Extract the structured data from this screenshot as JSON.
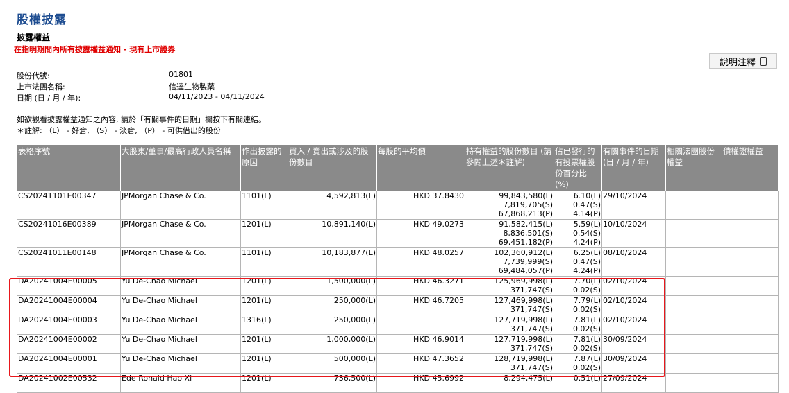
{
  "header": {
    "page_title": "股權披露",
    "section_title": "披露權益",
    "subtitle": "在指明期間內所有披露權益通知 - 現有上市證券",
    "help_button": "說明注釋"
  },
  "info": {
    "stock_code_label": "股份代號:",
    "stock_code": "01801",
    "company_label": "上市法團名稱:",
    "company": "信達生物製藥",
    "date_label": "日期 (日 / 月 / 年):",
    "date_range": "04/11/2023 - 04/11/2024"
  },
  "notes": {
    "line1": "如欲觀看披露權益通知之內容, 請於「有關事件的日期」欄按下有關連結。",
    "line2": "＊註解: （L） - 好倉, （S） - 淡倉, （P） - 可供借出的股份"
  },
  "table": {
    "headers": [
      "表格序號",
      "大股東/董事/最高行政人員名稱",
      "作出披露的原因",
      "買入 / 賣出或涉及的股份數目",
      "每股的平均價",
      "持有權益的股份數目 (請參閱上述＊註解)",
      "佔已發行的有投票權股份百分比 (%)",
      "有關事件的日期 (日 / 月 / 年)",
      "相關法團股份權益",
      "債權證權益"
    ],
    "rows": [
      {
        "form": "CS20241101E00347",
        "name": "JPMorgan Chase & Co.",
        "reason": "1101(L)",
        "shares": "4,592,813(L)",
        "price": "HKD 37.8430",
        "held": [
          "99,843,580(L)",
          "7,819,705(S)",
          "67,868,213(P)"
        ],
        "pct": [
          "6.10(L)",
          "0.47(S)",
          "4.14(P)"
        ],
        "date": "29/10/2024"
      },
      {
        "form": "CS20241016E00389",
        "name": "JPMorgan Chase & Co.",
        "reason": "1201(L)",
        "shares": "10,891,140(L)",
        "price": "HKD 49.0273",
        "held": [
          "91,582,415(L)",
          "8,836,501(S)",
          "69,451,182(P)"
        ],
        "pct": [
          "5.59(L)",
          "0.54(S)",
          "4.24(P)"
        ],
        "date": "10/10/2024"
      },
      {
        "form": "CS20241011E00148",
        "name": "JPMorgan Chase & Co.",
        "reason": "1101(L)",
        "shares": "10,183,877(L)",
        "price": "HKD 48.0257",
        "held": [
          "102,360,912(L)",
          "7,739,999(S)",
          "69,484,057(P)"
        ],
        "pct": [
          "6.25(L)",
          "0.47(S)",
          "4.24(P)"
        ],
        "date": "08/10/2024"
      },
      {
        "form": "DA20241004E00005",
        "name": "Yu De-Chao Michael",
        "reason": "1201(L)",
        "shares": "1,500,000(L)",
        "price": "HKD 46.3271",
        "held": [
          "125,969,998(L)",
          "371,747(S)"
        ],
        "pct": [
          "7.70(L)",
          "0.02(S)"
        ],
        "date": "02/10/2024"
      },
      {
        "form": "DA20241004E00004",
        "name": "Yu De-Chao Michael",
        "reason": "1201(L)",
        "shares": "250,000(L)",
        "price": "HKD 46.7205",
        "held": [
          "127,469,998(L)",
          "371,747(S)"
        ],
        "pct": [
          "7.79(L)",
          "0.02(S)"
        ],
        "date": "02/10/2024"
      },
      {
        "form": "DA20241004E00003",
        "name": "Yu De-Chao Michael",
        "reason": "1316(L)",
        "shares": "250,000(L)",
        "price": "",
        "held": [
          "127,719,998(L)",
          "371,747(S)"
        ],
        "pct": [
          "7.81(L)",
          "0.02(S)"
        ],
        "date": "02/10/2024"
      },
      {
        "form": "DA20241004E00002",
        "name": "Yu De-Chao Michael",
        "reason": "1201(L)",
        "shares": "1,000,000(L)",
        "price": "HKD 46.9014",
        "held": [
          "127,719,998(L)",
          "371,747(S)"
        ],
        "pct": [
          "7.81(L)",
          "0.02(S)"
        ],
        "date": "30/09/2024"
      },
      {
        "form": "DA20241004E00001",
        "name": "Yu De-Chao Michael",
        "reason": "1201(L)",
        "shares": "500,000(L)",
        "price": "HKD 47.3652",
        "held": [
          "128,719,998(L)",
          "371,747(S)"
        ],
        "pct": [
          "7.87(L)",
          "0.02(S)"
        ],
        "date": "30/09/2024"
      },
      {
        "form": "DA20241002E00532",
        "name": "Ede Ronald Hao Xi",
        "reason": "1201(L)",
        "shares": "736,500(L)",
        "price": "HKD 45.6992",
        "held": [
          "8,294,475(L)"
        ],
        "pct": [
          "0.51(L)"
        ],
        "date": "27/09/2024"
      }
    ]
  },
  "colors": {
    "title_blue": "#1e4d91",
    "subtitle_red": "#e00000",
    "header_gray": "#8a8a8a",
    "highlight_red": "#e8171c"
  },
  "icons": {
    "help_icon": "document-icon"
  }
}
